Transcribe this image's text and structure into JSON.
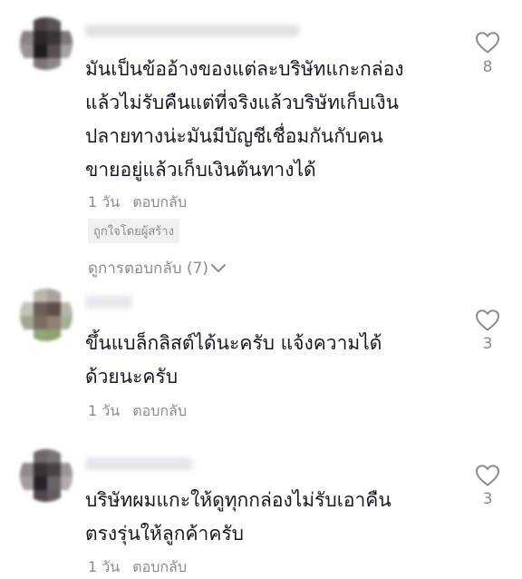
{
  "icons": {
    "like": "heart-outline-icon",
    "expand": "chevron-down-icon"
  },
  "colors": {
    "text": "#161823",
    "muted": "#8a8b91",
    "badge_bg": "#f1f1f2"
  },
  "comments": [
    {
      "text": "มันเป็นข้ออ้างของแต่ละบริษัทแกะกล่อง\nแล้วไม่รับคืนแต่ที่จริงแล้วบริษัทเก็บเงิน\nปลายทางน่ะมันมีบัญชีเชื่อมกันกับคน\nขายอยู่แล้วเก็บเงินต้นทางได้",
      "time": "1 วัน",
      "reply_label": "ตอบกลับ",
      "badge": "ถูกใจโดยผู้สร้าง",
      "view_replies": "ดูการตอบกลับ (7)",
      "likes": "8"
    },
    {
      "text": "ขึ้นแบล็กลิสต์ได้นะครับ แจ้งความได้\nด้วยนะครับ",
      "time": "1 วัน",
      "reply_label": "ตอบกลับ",
      "likes": "3"
    },
    {
      "text": "บริษัทผมแกะให้ดูทุกกล่องไม่รับเอาคืน\nตรงรุ่นให้ลูกค้าครับ",
      "time": "1 วัน",
      "reply_label": "ตอบกลับ",
      "likes": "3"
    }
  ]
}
